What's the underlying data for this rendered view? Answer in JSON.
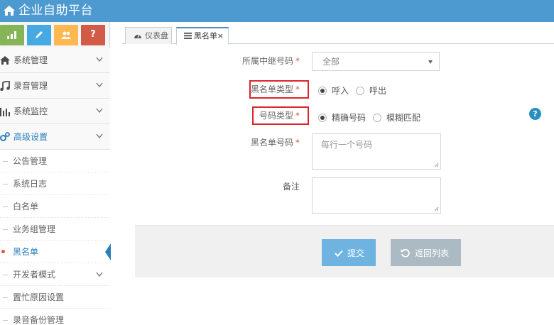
{
  "app": {
    "title": "企业自助平台"
  },
  "sidebar": {
    "items": [
      {
        "label": "系统管理"
      },
      {
        "label": "录音管理"
      },
      {
        "label": "系统监控"
      },
      {
        "label": "高级设置"
      }
    ],
    "subitems": [
      {
        "label": "公告管理"
      },
      {
        "label": "系统日志"
      },
      {
        "label": "白名单"
      },
      {
        "label": "业务组管理"
      },
      {
        "label": "黑名单"
      },
      {
        "label": "开发者模式"
      },
      {
        "label": "置忙原因设置"
      },
      {
        "label": "录音备份管理"
      }
    ]
  },
  "tabs": [
    {
      "label": "仪表盘"
    },
    {
      "label": "黑名单",
      "close": "×"
    }
  ],
  "form": {
    "trunk": {
      "label": "所属中继号码",
      "required": "*",
      "value": "全部"
    },
    "list_type": {
      "label": "黑名单类型",
      "required": "*",
      "options": [
        "呼入",
        "呼出"
      ],
      "selected": "呼入"
    },
    "number_type": {
      "label": "号码类型",
      "required": "*",
      "options": [
        "精确号码",
        "模糊匹配"
      ],
      "selected": "精确号码"
    },
    "numbers": {
      "label": "黑名单号码",
      "required": "*",
      "placeholder": "每行一个号码"
    },
    "remark": {
      "label": "备注"
    },
    "help": "?"
  },
  "actions": {
    "submit": "提交",
    "back": "返回列表"
  },
  "colors": {
    "header": "#4d9ad0",
    "active": "#2b7dbc",
    "submit": "#6fb3e0",
    "back": "#abbac3",
    "highlight_box": "#d9252b"
  }
}
